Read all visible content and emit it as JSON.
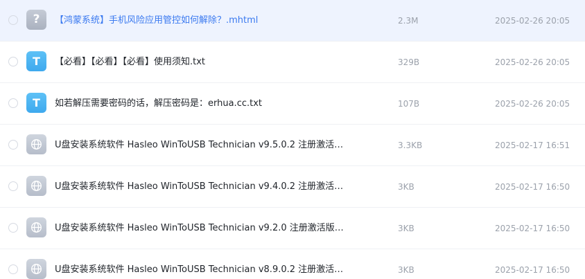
{
  "files": [
    {
      "name": "【鸿蒙系统】手机风险应用管控如何解除？.mhtml",
      "size": "2.3M",
      "date": "2025-02-26 20:05",
      "icon": "question-icon",
      "icon_glyph": "?"
    },
    {
      "name": "【必看】【必看】【必看】使用须知.txt",
      "size": "329B",
      "date": "2025-02-26 20:05",
      "icon": "text-file-icon",
      "icon_glyph": "T"
    },
    {
      "name": "如若解压需要密码的话，解压密码是：erhua.cc.txt",
      "size": "107B",
      "date": "2025-02-26 20:05",
      "icon": "text-file-icon",
      "icon_glyph": "T"
    },
    {
      "name": "U盘安装系统软件 Hasleo WinToUSB Technician v9.5.0.2 注册激活…",
      "size": "3.3KB",
      "date": "2025-02-17 16:51",
      "icon": "globe-icon"
    },
    {
      "name": "U盘安装系统软件 Hasleo WinToUSB Technician v9.4.0.2 注册激活…",
      "size": "3KB",
      "date": "2025-02-17 16:50",
      "icon": "globe-icon"
    },
    {
      "name": "U盘安装系统软件 Hasleo WinToUSB Technician v9.2.0 注册激活版…",
      "size": "3KB",
      "date": "2025-02-17 16:50",
      "icon": "globe-icon"
    },
    {
      "name": "U盘安装系统软件 Hasleo WinToUSB Technician v8.9.0.2 注册激活…",
      "size": "3KB",
      "date": "2025-02-17 16:50",
      "icon": "globe-icon"
    }
  ],
  "colors": {
    "highlight_row_bg": "#eef3fe",
    "highlight_text": "#3b7af0",
    "text_icon": "#3ea9ee",
    "unknown_icon": "#aab1bf",
    "web_icon": "#b6bdca",
    "meta_text": "#9ba1ab"
  }
}
